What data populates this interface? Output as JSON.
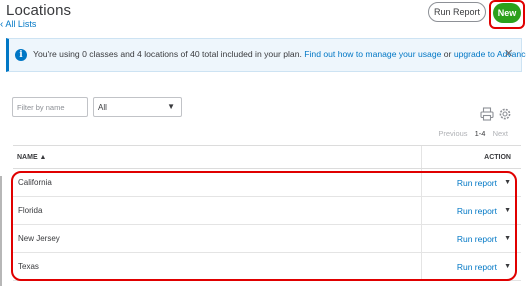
{
  "header": {
    "title": "Locations",
    "breadcrumb": "All Lists",
    "run_report_label": "Run Report",
    "new_label": "New"
  },
  "banner": {
    "message": "You're using 0 classes and 4 locations of 40 total included in your plan.",
    "link_usage": "Find out how to manage your usage",
    "or_text": "or",
    "link_upgrade": "upgrade to Advanced",
    "close_icon": "close-icon"
  },
  "filters": {
    "search_placeholder": "Filter by name",
    "status_value": "All"
  },
  "pager": {
    "previous": "Previous",
    "range": "1-4",
    "next": "Next"
  },
  "table": {
    "col_name": "NAME ▲",
    "col_action": "ACTION",
    "rows": [
      {
        "name": "California",
        "action": "Run report"
      },
      {
        "name": "Florida",
        "action": "Run report"
      },
      {
        "name": "New Jersey",
        "action": "Run report"
      },
      {
        "name": "Texas",
        "action": "Run report"
      }
    ]
  },
  "colors": {
    "brand_blue": "#0077c5",
    "new_green": "#2ca01c",
    "highlight_red": "#e00000"
  }
}
